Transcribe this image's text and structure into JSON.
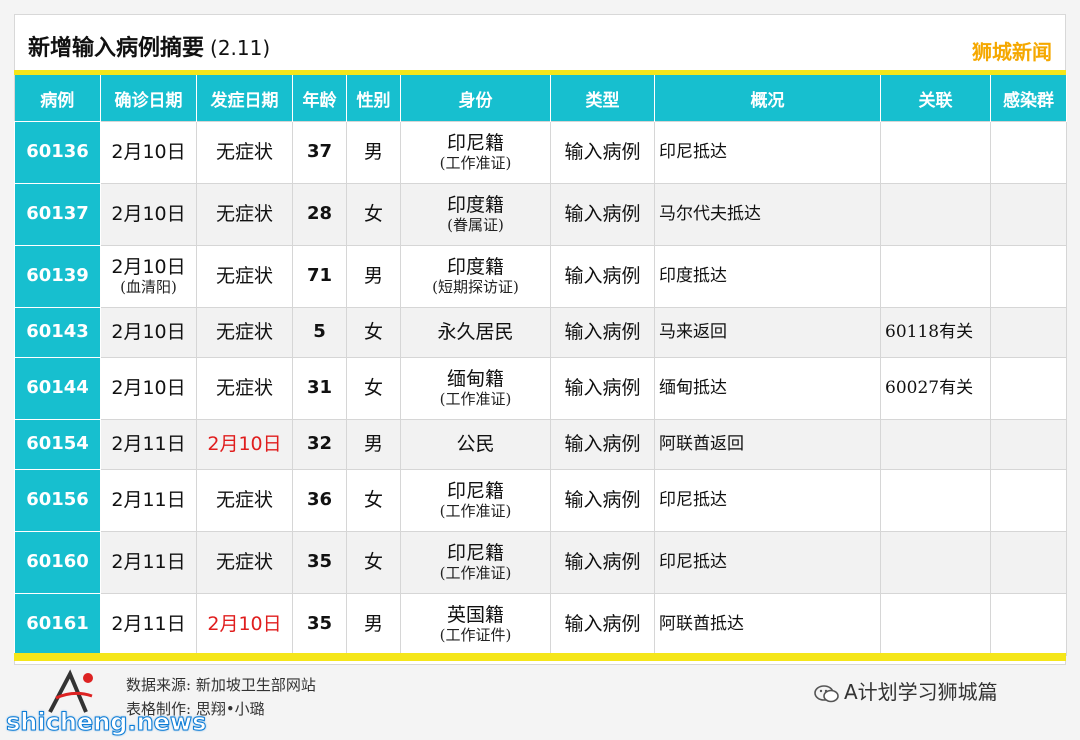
{
  "header": {
    "title": "新增输入病例摘要",
    "date": "(2.11)",
    "brand": "狮城新闻"
  },
  "table": {
    "columns": [
      "病例",
      "确诊日期",
      "发症日期",
      "年龄",
      "性别",
      "身份",
      "类型",
      "概况",
      "关联",
      "感染群"
    ],
    "rows": [
      {
        "id": "60136",
        "confirm": "2月10日",
        "confirm_note": "",
        "onset": "无症状",
        "onset_red": false,
        "age": "37",
        "sex": "男",
        "identity": "印尼籍",
        "identity_note": "(工作准证)",
        "type": "输入病例",
        "summary": "印尼抵达",
        "link": "",
        "cluster": ""
      },
      {
        "id": "60137",
        "confirm": "2月10日",
        "confirm_note": "",
        "onset": "无症状",
        "onset_red": false,
        "age": "28",
        "sex": "女",
        "identity": "印度籍",
        "identity_note": "(眷属证)",
        "type": "输入病例",
        "summary": "马尔代夫抵达",
        "link": "",
        "cluster": ""
      },
      {
        "id": "60139",
        "confirm": "2月10日",
        "confirm_note": "(血清阳)",
        "onset": "无症状",
        "onset_red": false,
        "age": "71",
        "sex": "男",
        "identity": "印度籍",
        "identity_note": "(短期探访证)",
        "type": "输入病例",
        "summary": "印度抵达",
        "link": "",
        "cluster": ""
      },
      {
        "id": "60143",
        "confirm": "2月10日",
        "confirm_note": "",
        "onset": "无症状",
        "onset_red": false,
        "age": "5",
        "sex": "女",
        "identity": "永久居民",
        "identity_note": "",
        "type": "输入病例",
        "summary": "马来返回",
        "link": "60118有关",
        "cluster": ""
      },
      {
        "id": "60144",
        "confirm": "2月10日",
        "confirm_note": "",
        "onset": "无症状",
        "onset_red": false,
        "age": "31",
        "sex": "女",
        "identity": "缅甸籍",
        "identity_note": "(工作准证)",
        "type": "输入病例",
        "summary": "缅甸抵达",
        "link": "60027有关",
        "cluster": ""
      },
      {
        "id": "60154",
        "confirm": "2月11日",
        "confirm_note": "",
        "onset": "2月10日",
        "onset_red": true,
        "age": "32",
        "sex": "男",
        "identity": "公民",
        "identity_note": "",
        "type": "输入病例",
        "summary": "阿联酋返回",
        "link": "",
        "cluster": ""
      },
      {
        "id": "60156",
        "confirm": "2月11日",
        "confirm_note": "",
        "onset": "无症状",
        "onset_red": false,
        "age": "36",
        "sex": "女",
        "identity": "印尼籍",
        "identity_note": "(工作准证)",
        "type": "输入病例",
        "summary": "印尼抵达",
        "link": "",
        "cluster": ""
      },
      {
        "id": "60160",
        "confirm": "2月11日",
        "confirm_note": "",
        "onset": "无症状",
        "onset_red": false,
        "age": "35",
        "sex": "女",
        "identity": "印尼籍",
        "identity_note": "(工作准证)",
        "type": "输入病例",
        "summary": "印尼抵达",
        "link": "",
        "cluster": ""
      },
      {
        "id": "60161",
        "confirm": "2月11日",
        "confirm_note": "",
        "onset": "2月10日",
        "onset_red": true,
        "age": "35",
        "sex": "男",
        "identity": "英国籍",
        "identity_note": "(工作证件)",
        "type": "输入病例",
        "summary": "阿联酋抵达",
        "link": "",
        "cluster": ""
      }
    ]
  },
  "footer": {
    "source": "数据来源: 新加坡卫生部网站",
    "maker": "表格制作: 思翔•小璐",
    "wechat_label": "A计划学习狮城篇",
    "watermark": "shicheng.news"
  },
  "colors": {
    "header_teal": "#17bfcf",
    "accent_yellow": "#f5e61a",
    "brand_orange": "#f5a800",
    "alert_red": "#e01e1e"
  }
}
